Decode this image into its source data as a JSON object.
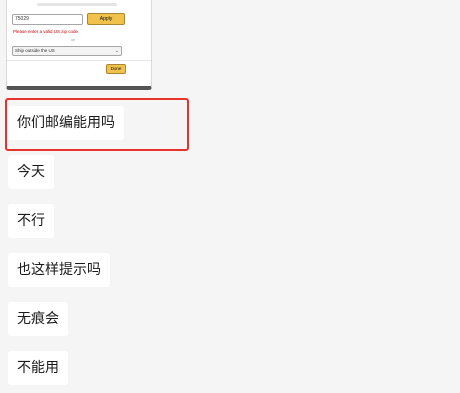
{
  "image_message": {
    "zip_value": "75029",
    "apply_label": "Apply",
    "error_text": "Please enter a valid US zip code",
    "or_text": "or",
    "ship_select_value": "Ship outside the US",
    "done_label": "Done"
  },
  "messages": [
    {
      "text": "你们邮编能用吗",
      "highlighted": true
    },
    {
      "text": "今天"
    },
    {
      "text": "不行"
    },
    {
      "text": "也这样提示吗"
    },
    {
      "text": "无痕会"
    },
    {
      "text": "不能用"
    }
  ],
  "colors": {
    "highlight_border": "#e8332c",
    "bubble_bg": "#ffffff",
    "chat_bg": "#f5f5f5"
  }
}
